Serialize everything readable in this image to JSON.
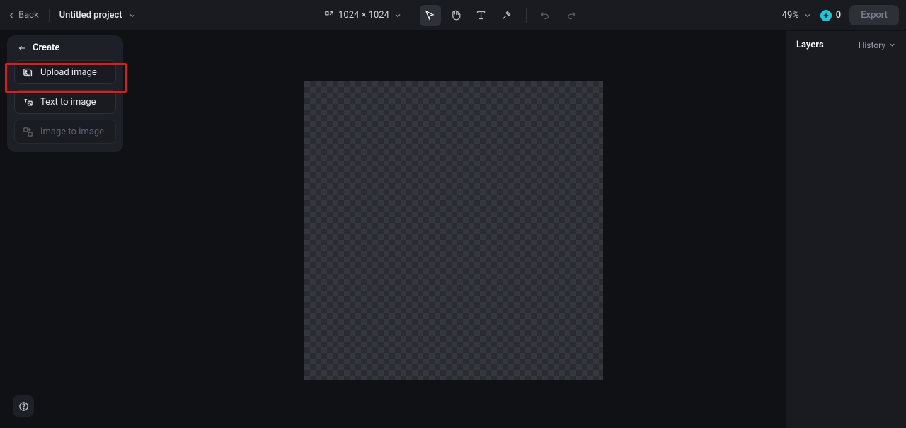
{
  "header": {
    "back": "Back",
    "title": "Untitled project",
    "canvas_size": "1024 × 1024",
    "zoom": "49%",
    "credits": "0",
    "export": "Export"
  },
  "left_panel": {
    "title": "Create",
    "upload": "Upload image",
    "text_to_image": "Text to image",
    "image_to_image": "Image to image"
  },
  "right_panel": {
    "layers": "Layers",
    "history": "History"
  }
}
